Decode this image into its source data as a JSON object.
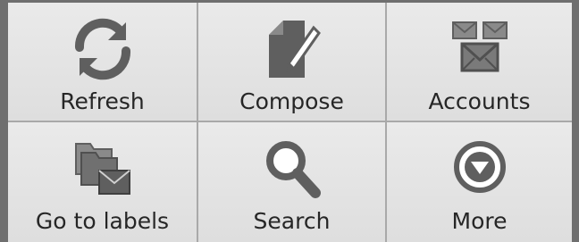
{
  "menu": {
    "items": [
      {
        "label": "Refresh",
        "icon": "refresh-icon"
      },
      {
        "label": "Compose",
        "icon": "compose-icon"
      },
      {
        "label": "Accounts",
        "icon": "accounts-icon"
      },
      {
        "label": "Go to labels",
        "icon": "labels-icon"
      },
      {
        "label": "Search",
        "icon": "search-icon"
      },
      {
        "label": "More",
        "icon": "more-icon"
      }
    ]
  },
  "colors": {
    "frame": "#6f6f6f",
    "cell_background": "#e5e5e5",
    "divider": "#a9a9a9",
    "icon_fill": "#5f5f5f",
    "text": "#262626"
  }
}
